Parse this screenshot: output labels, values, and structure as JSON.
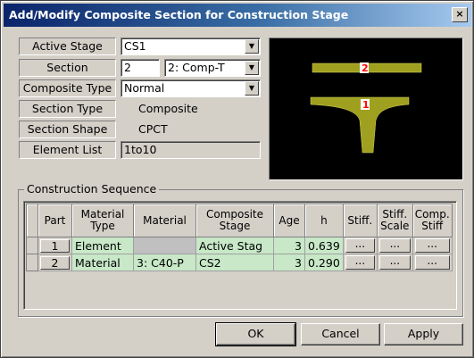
{
  "window": {
    "title": "Add/Modify Composite Section for Construction Stage",
    "close_symbol": "×"
  },
  "form": {
    "active_stage": {
      "label": "Active Stage",
      "value": "CS1"
    },
    "section": {
      "label": "Section",
      "number": "2",
      "value": "2: Comp-T"
    },
    "composite_type": {
      "label": "Composite Type",
      "value": "Normal"
    },
    "section_type": {
      "label": "Section Type",
      "value": "Composite"
    },
    "section_shape": {
      "label": "Section Shape",
      "value": "CPCT"
    },
    "element_list": {
      "label": "Element List",
      "value": "1to10"
    }
  },
  "preview": {
    "slab_label": "2",
    "girder_label": "1",
    "shape_color": "#a0a020",
    "label_color": "#ff0000"
  },
  "construction_sequence": {
    "title": "Construction Sequence",
    "columns": [
      "Part",
      "Material\nType",
      "Material",
      "Composite\nStage",
      "Age",
      "h",
      "Stiff.",
      "Stiff.\nScale",
      "Comp.\nStiff"
    ],
    "rows": [
      {
        "part": "1",
        "material_type": "Element",
        "material": "",
        "composite_stage": "Active Stag",
        "age": "3",
        "h": "0.639",
        "stiff": "...",
        "stiff_scale": "...",
        "comp_stiff": "..."
      },
      {
        "part": "2",
        "material_type": "Material",
        "material": "3: C40-P",
        "composite_stage": "CS2",
        "age": "3",
        "h": "0.290",
        "stiff": "...",
        "stiff_scale": "...",
        "comp_stiff": "..."
      }
    ]
  },
  "buttons": {
    "ok": "OK",
    "cancel": "Cancel",
    "apply": "Apply"
  },
  "icons": {
    "dropdown": "▼"
  }
}
